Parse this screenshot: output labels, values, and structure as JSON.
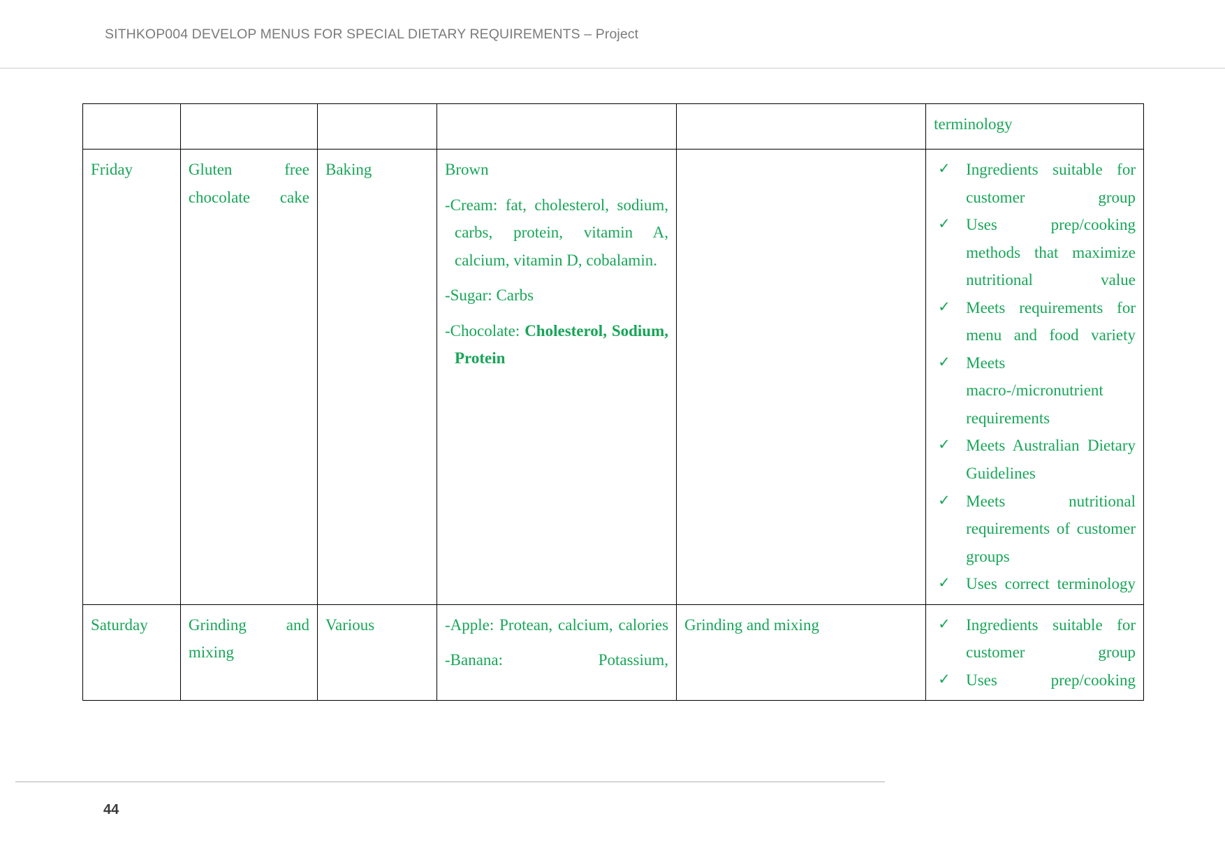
{
  "document": {
    "header_text": "SITHKOP004 DEVELOP MENUS FOR SPECIAL DIETARY REQUIREMENTS – Project",
    "page_number": "44",
    "text_color": "#18a558",
    "header_color": "#7b7b7b"
  },
  "table": {
    "continuation_row": {
      "day": "",
      "dish": "",
      "method": "",
      "nutrition": "",
      "modifications": "",
      "checklist_text": "terminology"
    },
    "rows": [
      {
        "day": "Friday",
        "dish": "Gluten free chocolate cake",
        "method": "Baking",
        "nutrition_color_note": "Brown",
        "nutrition": [
          {
            "label": "-Cream:",
            "text": "-Cream: fat, cholesterol, sodium, carbs, protein, vitamin A, calcium, vitamin D, cobalamin.",
            "bold": false
          },
          {
            "label": "-Sugar:",
            "text": "-Sugar: Carbs",
            "bold": false
          },
          {
            "label": "-Chocolate:",
            "text": "-Chocolate:",
            "bold_text": "Cholesterol, Sodium, Protein"
          }
        ],
        "modifications": "",
        "checklist": [
          "Ingredients suitable for customer group",
          "Uses prep/cooking methods that maximize nutritional value",
          "Meets requirements for menu and food variety",
          "Meets macro-/micronutrient requirements",
          "Meets Australian Dietary Guidelines",
          "Meets nutritional requirements of customer groups",
          "Uses correct terminology"
        ]
      },
      {
        "day": "Saturday",
        "dish": "Grinding and mixing",
        "method": "Various",
        "nutrition_color_note": "",
        "nutrition": [
          {
            "label": "-Apple:",
            "text": "-Apple: Protean, calcium, calories",
            "bold": false
          },
          {
            "label": "-Banana:",
            "text": "-Banana: Potassium,",
            "bold": false
          }
        ],
        "modifications": "Grinding and mixing",
        "checklist": [
          "Ingredients suitable for customer group",
          "Uses prep/cooking"
        ]
      }
    ]
  },
  "icons": {
    "check": "✓"
  }
}
